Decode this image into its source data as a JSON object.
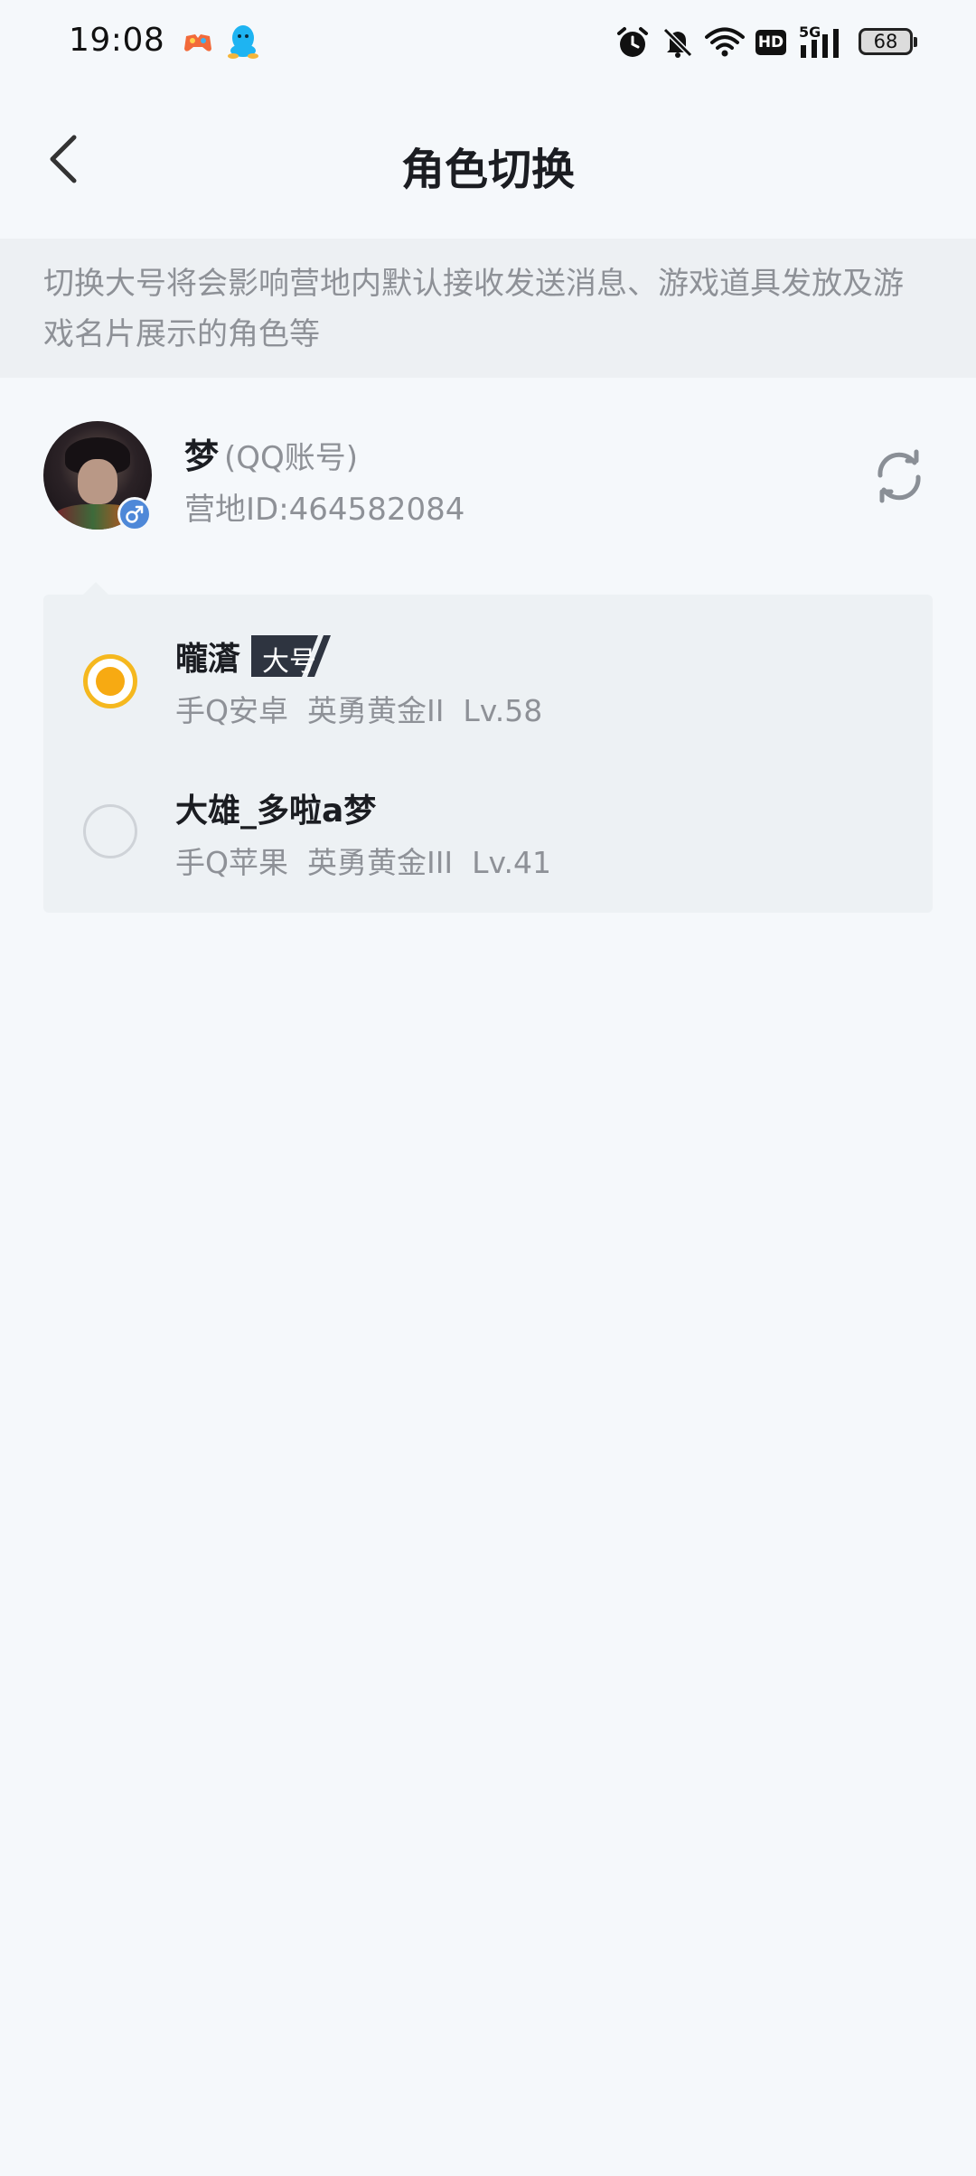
{
  "status_bar": {
    "time": "19:08",
    "network_badge": "HD",
    "signal_label": "5G",
    "battery": "68",
    "icons": [
      "game-app-icon",
      "qq-icon",
      "alarm-icon",
      "mute-icon",
      "wifi-icon",
      "hd-icon",
      "signal-5g-icon",
      "battery-icon"
    ]
  },
  "header": {
    "title": "角色切换",
    "back_icon": "chevron-left-icon"
  },
  "notice": {
    "text": "切换大号将会影响营地内默认接收发送消息、游戏道具发放及游戏名片展示的角色等"
  },
  "account": {
    "name": "梦",
    "type": "(QQ账号)",
    "camp_id": "营地ID:464582084",
    "gender_icon": "male-icon",
    "refresh_icon": "refresh-icon"
  },
  "roles": [
    {
      "name": "曨濸",
      "badge": "大号",
      "platform": "手Q安卓",
      "rank": "英勇黄金II",
      "level": "Lv.58",
      "selected": true
    },
    {
      "name": "大雄_多啦a梦",
      "badge": "",
      "platform": "手Q苹果",
      "rank": "英勇黄金III",
      "level": "Lv.41",
      "selected": false
    }
  ],
  "colors": {
    "accent": "#f7aa12",
    "background": "#f5f8fb",
    "card": "#edf1f4",
    "muted_text": "#8e9197",
    "badge_bg": "#2e3440",
    "gender_badge": "#4e88d8"
  }
}
